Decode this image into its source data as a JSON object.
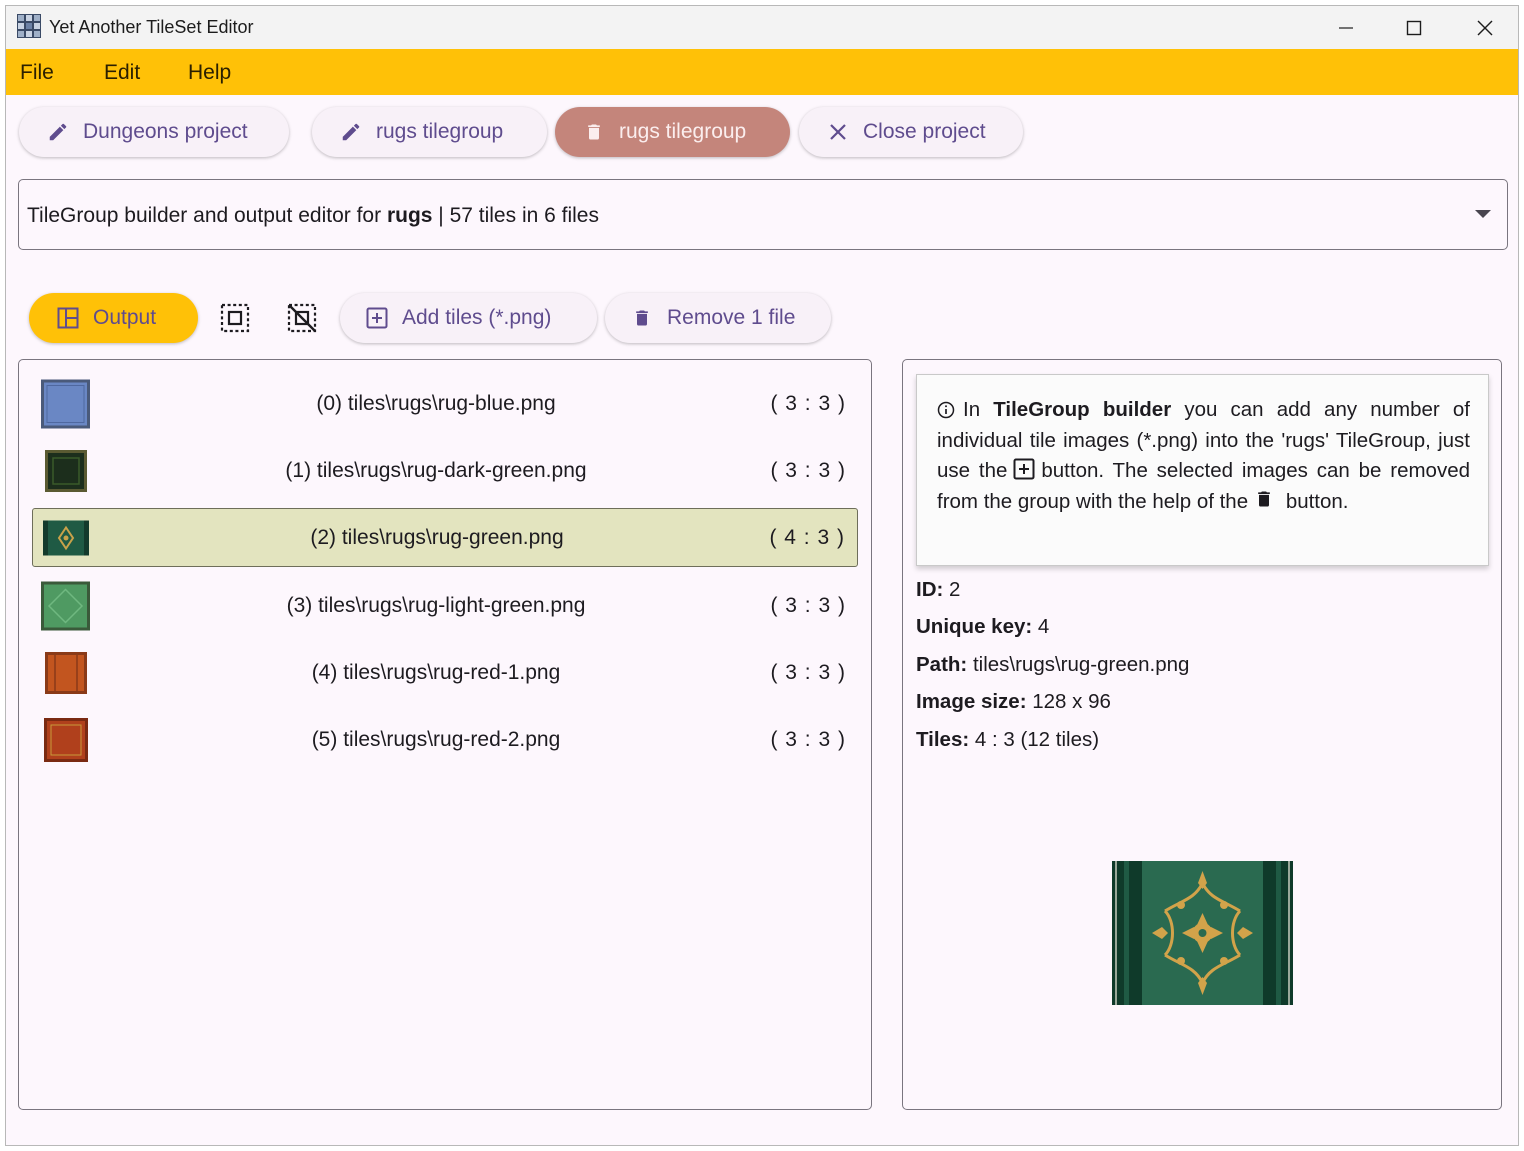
{
  "window": {
    "title": "Yet Another TileSet Editor",
    "accent_color": "#ffc107",
    "controls": [
      "minimize-icon",
      "maximize-icon",
      "close-icon"
    ]
  },
  "menu": {
    "file": "File",
    "edit": "Edit",
    "help": "Help"
  },
  "top_buttons": {
    "dungeons": "Dungeons project",
    "rugs_edit": "rugs tilegroup",
    "rugs_delete": "rugs tilegroup",
    "close_project": "Close project"
  },
  "selector": {
    "prefix": "TileGroup builder and output editor for ",
    "name": "rugs",
    "suffix": " | 57 tiles in 6 files"
  },
  "toolbar": {
    "output": "Output",
    "select_all_icon": "select-all-icon",
    "deselect_icon": "deselect-icon",
    "add_tiles": "Add tiles (*.png)",
    "remove": "Remove 1 file"
  },
  "files": [
    {
      "label": "(0) tiles\\rugs\\rug-blue.png",
      "ratio": "( 3 : 3 )",
      "color": "#5a76b8",
      "selected": false
    },
    {
      "label": "(1) tiles\\rugs\\rug-dark-green.png",
      "ratio": "( 3 : 3 )",
      "color": "#223a22",
      "selected": false
    },
    {
      "label": "(2) tiles\\rugs\\rug-green.png",
      "ratio": "( 4 : 3 )",
      "color": "#1f5a44",
      "selected": true
    },
    {
      "label": "(3) tiles\\rugs\\rug-light-green.png",
      "ratio": "( 3 : 3 )",
      "color": "#4f9a62",
      "selected": false
    },
    {
      "label": "(4) tiles\\rugs\\rug-red-1.png",
      "ratio": "( 3 : 3 )",
      "color": "#b4481f",
      "selected": false
    },
    {
      "label": "(5) tiles\\rugs\\rug-red-2.png",
      "ratio": "( 3 : 3 )",
      "color": "#a83a1c",
      "selected": false
    }
  ],
  "info": {
    "t1": "In ",
    "t2": "TileGroup builder",
    "t3": " you can add any number of individual tile images (*.png) into the 'rugs' TileGroup, just use the",
    "t4": "button. The selected images can be removed from the group with the help of the",
    "t5": "button."
  },
  "details": {
    "id_label": "ID:",
    "id_value": " 2",
    "key_label": "Unique key:",
    "key_value": " 4",
    "path_label": "Path:",
    "path_value": " tiles\\rugs\\rug-green.png",
    "size_label": "Image size:",
    "size_value": " 128 x 96",
    "tiles_label": "Tiles:",
    "tiles_value": " 4 : 3 (12 tiles)"
  }
}
